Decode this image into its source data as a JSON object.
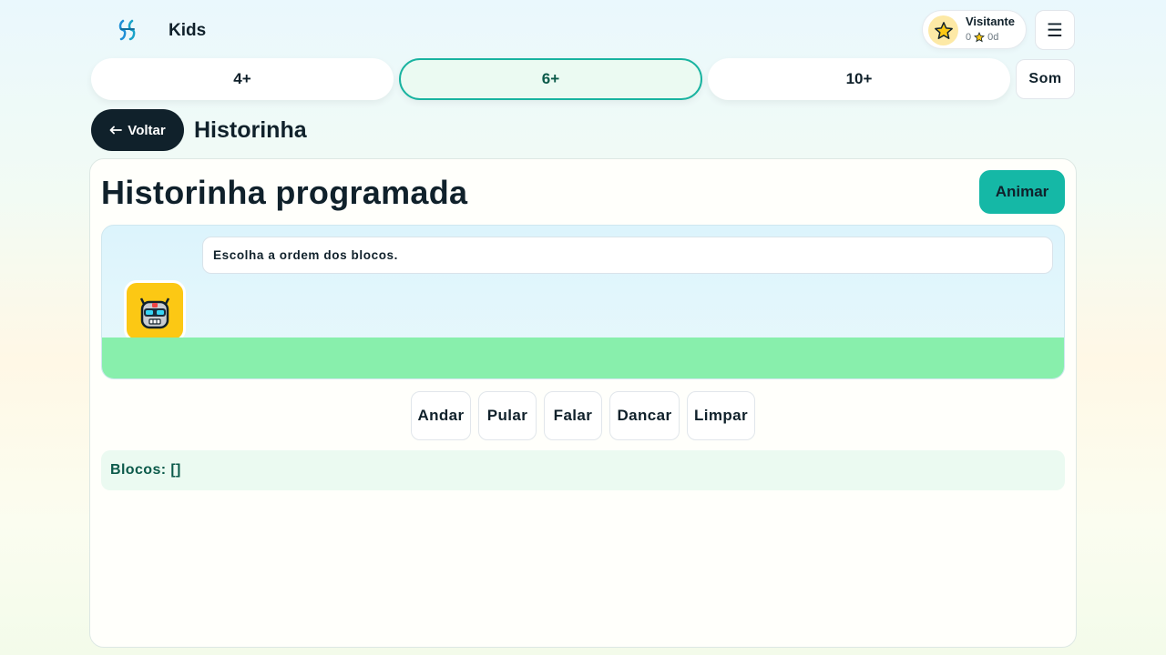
{
  "app": {
    "brand": "Kids"
  },
  "user": {
    "name": "Visitante",
    "stars": "0",
    "days": "0d"
  },
  "age_tabs": [
    {
      "label": "4+",
      "active": false
    },
    {
      "label": "6+",
      "active": true
    },
    {
      "label": "10+",
      "active": false
    }
  ],
  "sound_label": "Som",
  "back_label": "Voltar",
  "page_title": "Historinha",
  "activity": {
    "title": "Historinha programada",
    "animate_label": "Animar",
    "speech": "Escolha a ordem dos blocos.",
    "commands": [
      "Andar",
      "Pular",
      "Falar",
      "Dancar",
      "Limpar"
    ],
    "blocks_text": "Blocos: []"
  },
  "colors": {
    "accent": "#15b8a6",
    "dark": "#10212b",
    "ground": "#88efac",
    "robot_bg": "#fcc814"
  },
  "icons": {
    "logo": "kids-logo-icon",
    "avatar": "star-icon",
    "menu": "hamburger-icon",
    "back": "arrow-left-icon",
    "robot": "robot-icon"
  }
}
